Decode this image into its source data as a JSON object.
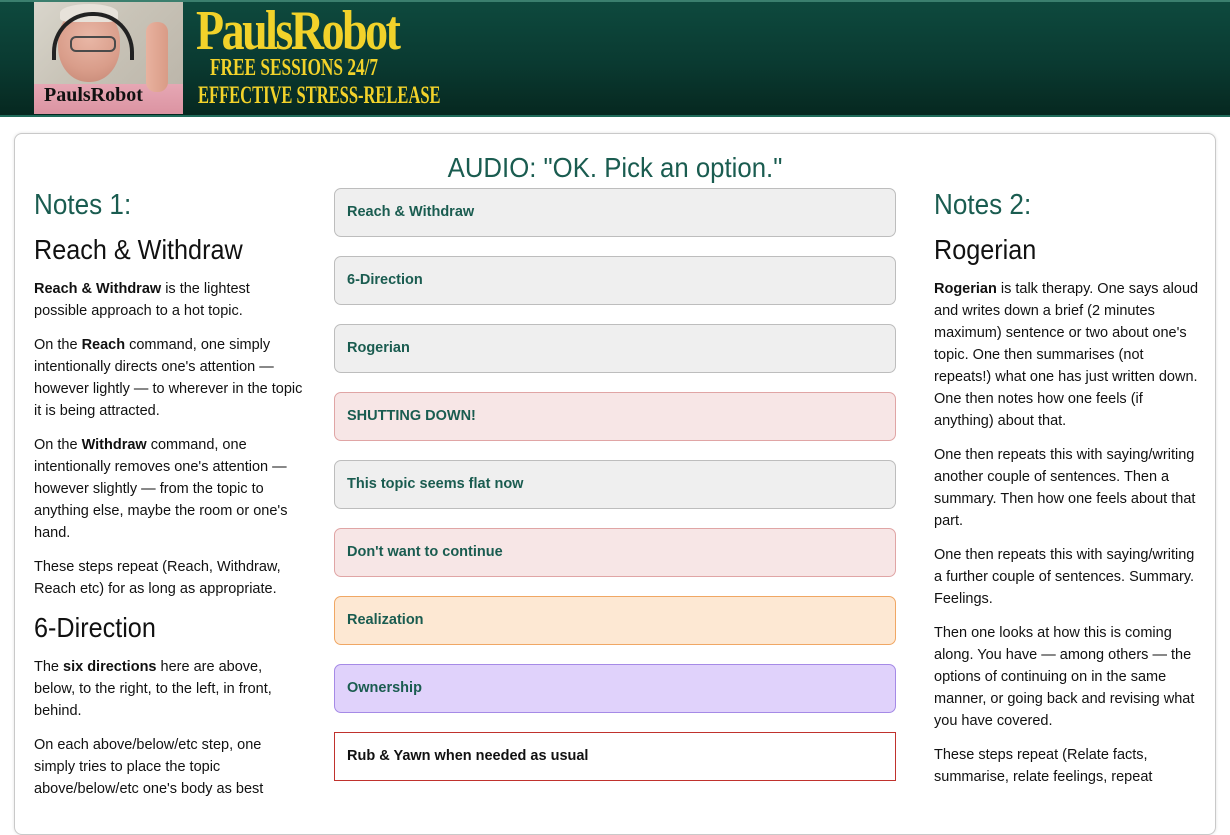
{
  "header": {
    "photo_name": "PaulsRobot",
    "brand_title": "PaulsRobot",
    "brand_line1": "FREE SESSIONS 24/7",
    "brand_line2": "EFFECTIVE STRESS-RELEASE"
  },
  "audio_title": "AUDIO: \"OK. Pick an option.\"",
  "left": {
    "notes_heading": "Notes 1:",
    "section1_heading": "Reach & Withdraw",
    "p1_bold": "Reach & Withdraw",
    "p1_rest": " is the lightest possible approach to a hot topic.",
    "p2_pre": "On the ",
    "p2_bold": "Reach",
    "p2_rest": " command, one simply intentionally directs one's attention — however lightly — to wherever in the topic it is being attracted.",
    "p3_pre": "On the ",
    "p3_bold": "Withdraw",
    "p3_rest": " command, one intentionally removes one's attention — however slightly — from the topic to anything else, maybe the room or one's hand.",
    "p4": "These steps repeat (Reach, Withdraw, Reach etc) for as long as appropriate.",
    "section2_heading": "6-Direction",
    "p5_pre": "The ",
    "p5_bold": "six directions",
    "p5_rest": " here are above, below, to the right, to the left, in front, behind.",
    "p6": "On each above/below/etc step, one simply tries to place the topic above/below/etc one's body as best"
  },
  "options": [
    {
      "label": "Reach & Withdraw",
      "style": "grey"
    },
    {
      "label": "6-Direction",
      "style": "grey"
    },
    {
      "label": "Rogerian",
      "style": "grey"
    },
    {
      "label": "SHUTTING DOWN!",
      "style": "red"
    },
    {
      "label": "This topic seems flat now",
      "style": "grey"
    },
    {
      "label": "Don't want to continue",
      "style": "red"
    },
    {
      "label": "Realization",
      "style": "orange"
    },
    {
      "label": "Ownership",
      "style": "purple"
    },
    {
      "label": "Rub & Yawn when needed as usual",
      "style": "plain"
    }
  ],
  "right": {
    "notes_heading": "Notes 2:",
    "section_heading": "Rogerian",
    "p1_bold": "Rogerian",
    "p1_rest": " is talk therapy. One says aloud and writes down a brief (2 minutes maximum) sentence or two about one's topic. One then summarises (not repeats!) what one has just written down. One then notes how one feels (if anything) about that.",
    "p2": "One then repeats this with saying/writing another couple of sentences. Then a summary. Then how one feels about that part.",
    "p3": "One then repeats this with saying/writing a further couple of sentences. Summary. Feelings.",
    "p4": "Then one looks at how this is coming along. You have — among others — the options of continuing on in the same manner, or going back and revising what you have covered.",
    "p5": "These steps repeat (Relate facts, summarise, relate feelings, repeat"
  },
  "colors": {
    "banner": "#0a3a31",
    "brand_yellow": "#f2d22a",
    "accent_green": "#1a5c50",
    "option_grey": "#efefef",
    "option_red": "#f7e6e6",
    "option_orange": "#fde8d3",
    "option_purple": "#e0d2fb"
  }
}
